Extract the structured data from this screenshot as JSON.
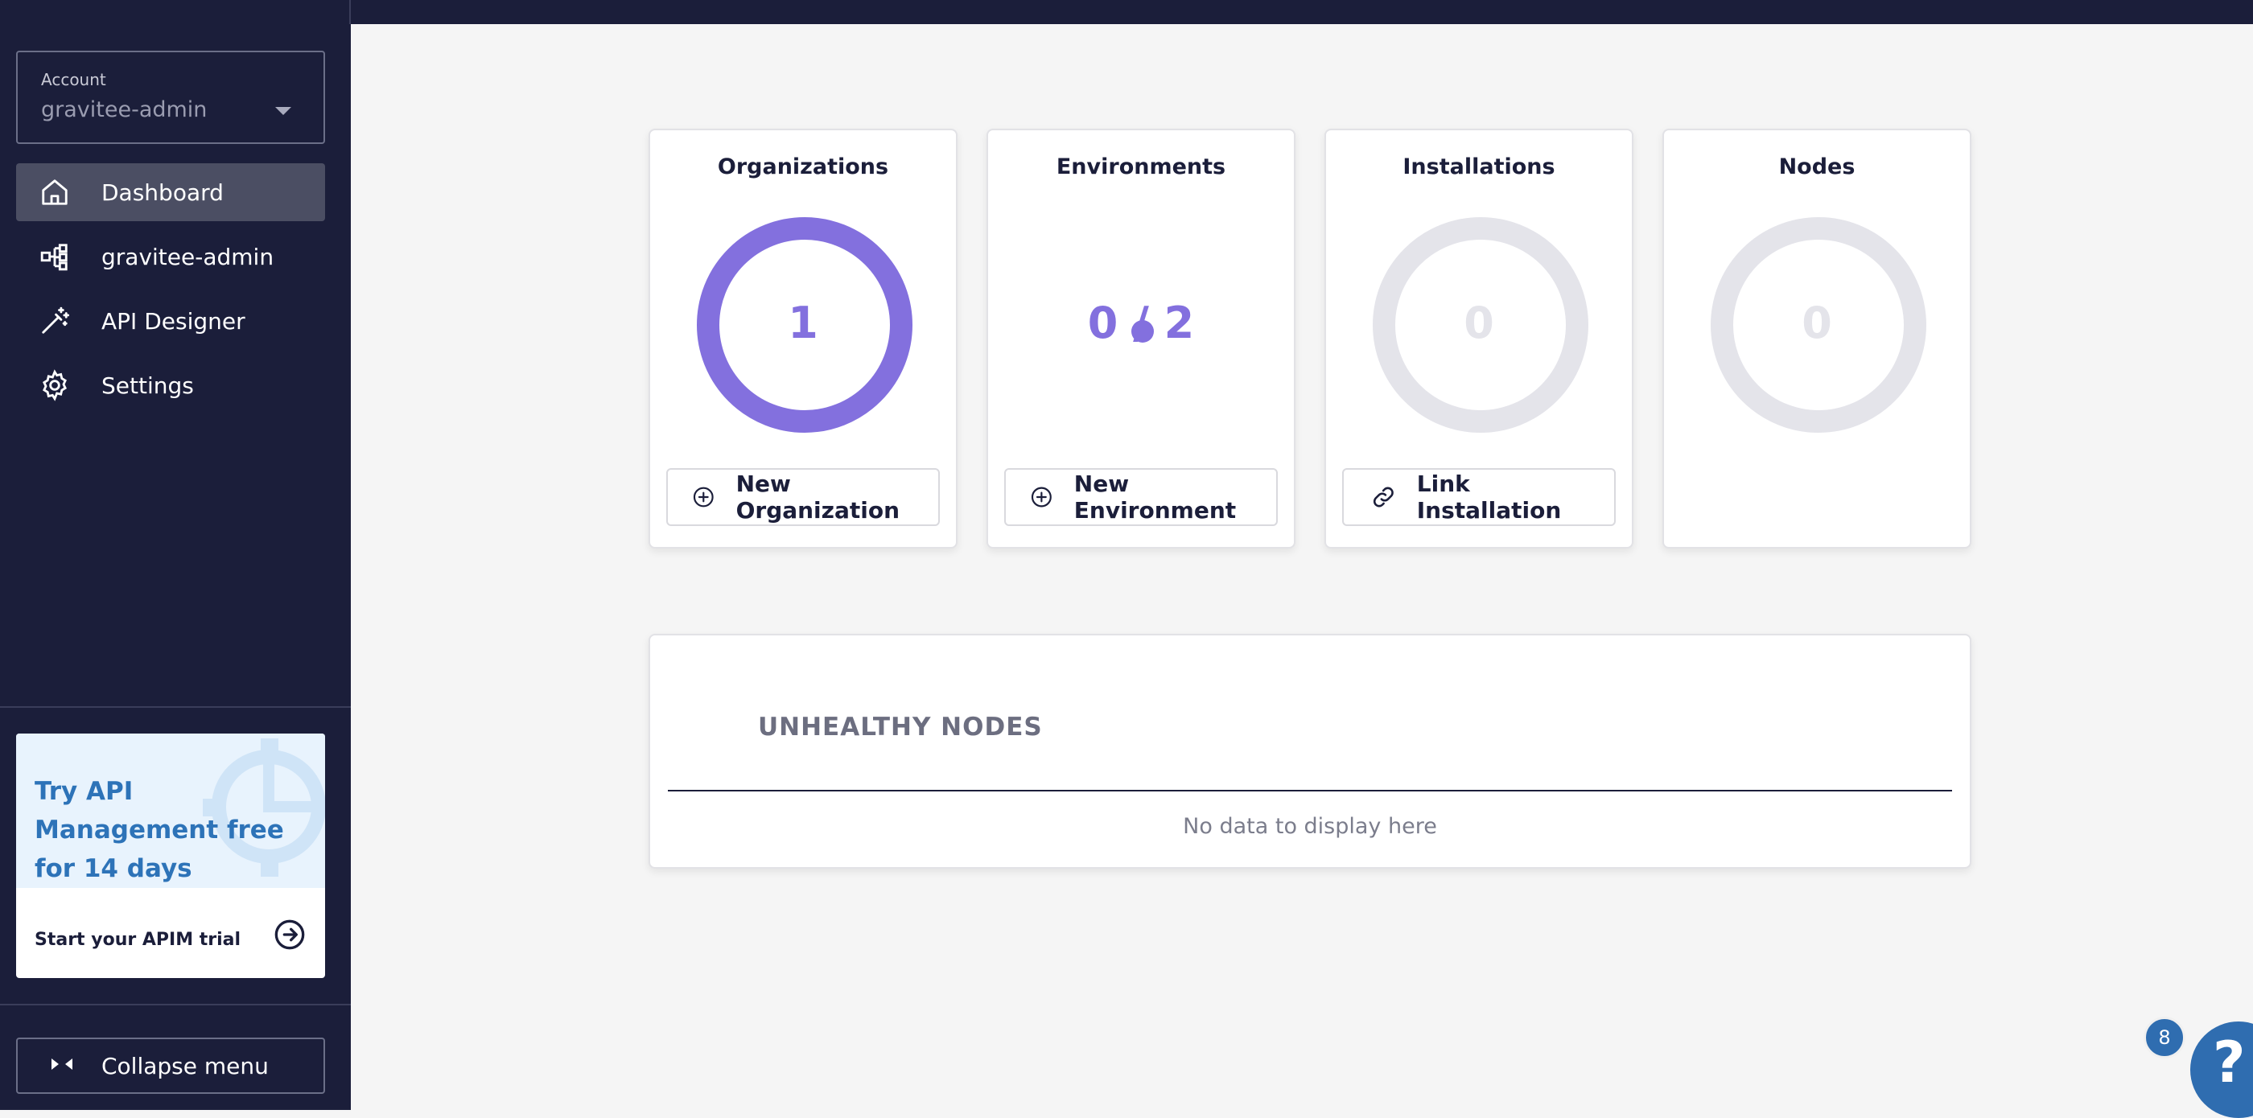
{
  "sidebar": {
    "account": {
      "label": "Account",
      "value": "gravitee-admin"
    },
    "items": [
      {
        "label": "Dashboard",
        "icon": "home-icon"
      },
      {
        "label": "gravitee-admin",
        "icon": "organization-icon"
      },
      {
        "label": "API Designer",
        "icon": "wand-icon"
      },
      {
        "label": "Settings",
        "icon": "gear-icon"
      }
    ],
    "promo": {
      "headline": "Try API Management free for 14 days",
      "cta": "Start your APIM trial"
    },
    "collapse_label": "Collapse menu"
  },
  "cards": {
    "organizations": {
      "title": "Organizations",
      "value": "1",
      "action": "New Organization"
    },
    "environments": {
      "title": "Environments",
      "value": "0 / 2",
      "action": "New Environment"
    },
    "installations": {
      "title": "Installations",
      "value": "0",
      "action": "Link Installation"
    },
    "nodes": {
      "title": "Nodes",
      "value": "0"
    }
  },
  "unhealthy": {
    "title": "UNHEALTHY NODES",
    "empty": "No data to display here"
  },
  "help": {
    "badge": "8",
    "symbol": "?"
  },
  "colors": {
    "sidebar_bg": "#1b1e3a",
    "accent": "#8370de",
    "brand_blue": "#2f6db0"
  }
}
